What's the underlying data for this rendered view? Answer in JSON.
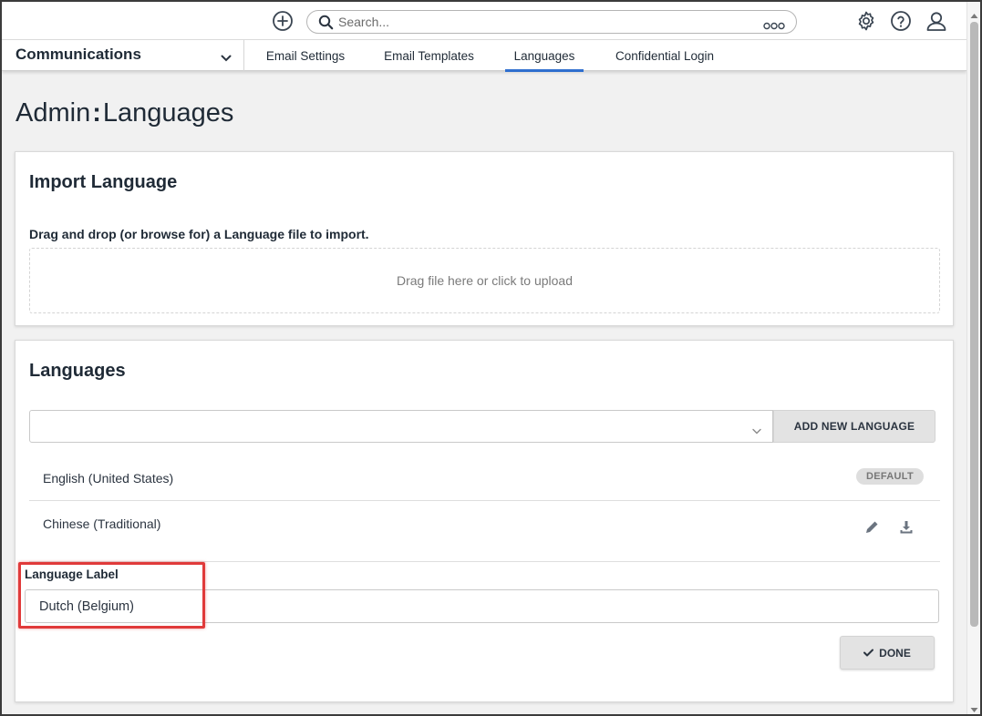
{
  "topbar": {
    "search": {
      "placeholder": "Search...",
      "value": ""
    },
    "icons": [
      "add-icon",
      "search-icon",
      "more-options-icon",
      "gear-icon",
      "help-icon",
      "user-icon"
    ]
  },
  "nav": {
    "section": "Communications",
    "tabs": [
      {
        "label": "Email Settings",
        "active": false
      },
      {
        "label": "Email Templates",
        "active": false
      },
      {
        "label": "Languages",
        "active": true
      },
      {
        "label": "Confidential Login",
        "active": false
      }
    ]
  },
  "page": {
    "title_prefix": "Admin",
    "title_separator": ":",
    "title_suffix": "Languages"
  },
  "import_card": {
    "title": "Import Language",
    "description": "Drag and drop (or browse for) a Language file to import.",
    "dropzone_text": "Drag file here or click to upload"
  },
  "languages_card": {
    "title": "Languages",
    "select_value": "",
    "add_button": "ADD NEW LANGUAGE",
    "items": [
      {
        "name": "English (United States)",
        "badge": "DEFAULT"
      },
      {
        "name": "Chinese (Traditional)",
        "badge": ""
      }
    ],
    "new_language": {
      "label": "Language Label",
      "value": "Dutch (Belgium)"
    },
    "done_button": "DONE"
  },
  "colors": {
    "accent": "#2f6fcf",
    "highlight": "#e03a3a"
  }
}
